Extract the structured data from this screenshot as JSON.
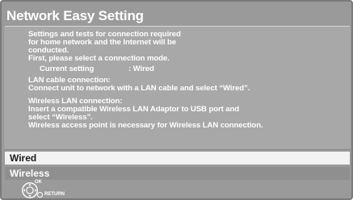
{
  "title": "Network Easy Setting",
  "intro": {
    "line1": "Settings and tests for connection required",
    "line2": "for home network and the Internet will be",
    "line3": "conducted.",
    "line4": "First, please select a connection mode."
  },
  "current_setting": {
    "label": "Current setting",
    "value": ": Wired"
  },
  "lan_section": {
    "heading": "LAN cable connection:",
    "line1": "Connect unit to network with a LAN cable and select “Wired”."
  },
  "wireless_section": {
    "heading": "Wireless LAN connection:",
    "line1": "Insert a compatible Wireless LAN Adaptor to USB port and",
    "line2": "select “Wireless”.",
    "line3": "Wireless access point is necessary for Wireless LAN connection."
  },
  "options": [
    {
      "label": "Wired",
      "selected": true
    },
    {
      "label": "Wireless",
      "selected": false
    }
  ],
  "footer": {
    "ok_label": "OK",
    "return_label": "RETURN",
    "nav_icon": "remote-dpad-icon",
    "return_icon": "return-circle-icon"
  }
}
